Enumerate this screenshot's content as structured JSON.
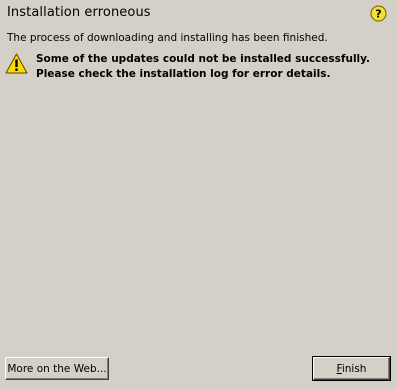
{
  "dialog": {
    "title": "Installation erroneous",
    "intro": "The process of downloading and installing has been finished.",
    "message": "Some of the updates could not be installed successfully. Please check the installation log for error details.",
    "help_icon": "help-question-icon",
    "warning_icon": "warning-triangle-icon"
  },
  "buttons": {
    "web_label": "More on the Web...",
    "finish_first": "F",
    "finish_rest": "inish"
  },
  "colors": {
    "background": "#d4d0c8",
    "help_icon": "#f5e12a",
    "warning_icon": "#ffd800"
  }
}
